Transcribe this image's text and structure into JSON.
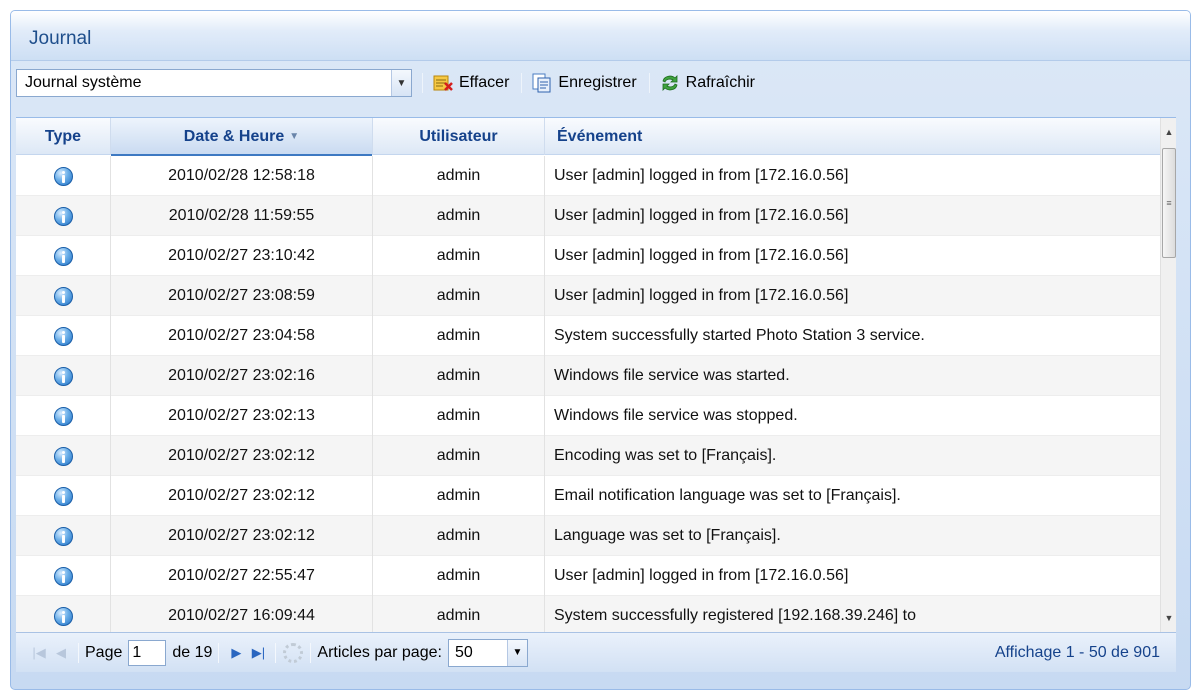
{
  "panel": {
    "title": "Journal"
  },
  "toolbar": {
    "log_select": "Journal système",
    "clear_label": "Effacer",
    "save_label": "Enregistrer",
    "refresh_label": "Rafraîchir"
  },
  "grid": {
    "columns": [
      "Type",
      "Date & Heure",
      "Utilisateur",
      "Événement"
    ],
    "sorted_column": "Date & Heure",
    "sort_direction": "descending",
    "rows": [
      {
        "type": "info-icon",
        "date": "2010/02/28 12:58:18",
        "user": "admin",
        "event": "User [admin] logged in from [172.16.0.56]"
      },
      {
        "type": "info-icon",
        "date": "2010/02/28 11:59:55",
        "user": "admin",
        "event": "User [admin] logged in from [172.16.0.56]"
      },
      {
        "type": "info-icon",
        "date": "2010/02/27 23:10:42",
        "user": "admin",
        "event": "User [admin] logged in from [172.16.0.56]"
      },
      {
        "type": "info-icon",
        "date": "2010/02/27 23:08:59",
        "user": "admin",
        "event": "User [admin] logged in from [172.16.0.56]"
      },
      {
        "type": "info-icon",
        "date": "2010/02/27 23:04:58",
        "user": "admin",
        "event": "System successfully started Photo Station 3 service."
      },
      {
        "type": "info-icon",
        "date": "2010/02/27 23:02:16",
        "user": "admin",
        "event": "Windows file service was started."
      },
      {
        "type": "info-icon",
        "date": "2010/02/27 23:02:13",
        "user": "admin",
        "event": "Windows file service was stopped."
      },
      {
        "type": "info-icon",
        "date": "2010/02/27 23:02:12",
        "user": "admin",
        "event": "Encoding was set to [Français]."
      },
      {
        "type": "info-icon",
        "date": "2010/02/27 23:02:12",
        "user": "admin",
        "event": "Email notification language was set to [Français]."
      },
      {
        "type": "info-icon",
        "date": "2010/02/27 23:02:12",
        "user": "admin",
        "event": "Language was set to [Français]."
      },
      {
        "type": "info-icon",
        "date": "2010/02/27 22:55:47",
        "user": "admin",
        "event": "User [admin] logged in from [172.16.0.56]"
      },
      {
        "type": "info-icon",
        "date": "2010/02/27 16:09:44",
        "user": "admin",
        "event": "System successfully registered [192.168.39.246] to"
      }
    ]
  },
  "pager": {
    "page_label": "Page",
    "page_value": "1",
    "of_label": "de 19",
    "per_page_label": "Articles par page:",
    "per_page_value": "50",
    "display_info": "Affichage 1 - 50 de 901"
  }
}
